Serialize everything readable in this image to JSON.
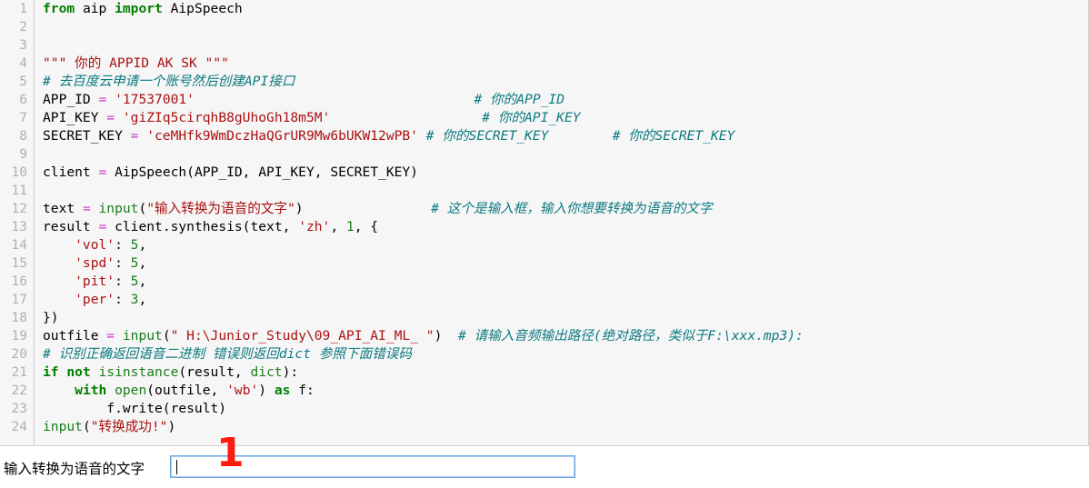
{
  "editor": {
    "background_color": "#f6f6f6",
    "gutter_color": "#b0b0b0",
    "line_numbers": [
      "1",
      "2",
      "3",
      "4",
      "5",
      "6",
      "7",
      "8",
      "9",
      "10",
      "11",
      "12",
      "13",
      "14",
      "15",
      "16",
      "17",
      "18",
      "19",
      "20",
      "21",
      "22",
      "23",
      "24"
    ],
    "lines": [
      {
        "n": "1",
        "text": "from aip import AipSpeech"
      },
      {
        "n": "2",
        "text": ""
      },
      {
        "n": "3",
        "text": ""
      },
      {
        "n": "4",
        "text": "\"\"\" 你的 APPID AK SK \"\"\""
      },
      {
        "n": "5",
        "text": "# 去百度云申请一个账号然后创建API接口"
      },
      {
        "n": "6",
        "text": "APP_ID = '17537001'                                    # 你的APP_ID"
      },
      {
        "n": "7",
        "text": "API_KEY = 'giZIq5cirqhB8gUhoGh18m5M'                    # 你的API_KEY"
      },
      {
        "n": "8",
        "text": "SECRET_KEY = 'ceMHfk9WmDczHaQGrUR9Mw6bUKW12wPB' # 你的SECRET_KEY        # 你的SECRET_KEY"
      },
      {
        "n": "9",
        "text": ""
      },
      {
        "n": "10",
        "text": "client = AipSpeech(APP_ID, API_KEY, SECRET_KEY)"
      },
      {
        "n": "11",
        "text": ""
      },
      {
        "n": "12",
        "text": "text = input(\"输入转换为语音的文字\")              # 这个是输入框，输入你想要转换为语音的文字"
      },
      {
        "n": "13",
        "text": "result = client.synthesis(text, 'zh', 1, {"
      },
      {
        "n": "14",
        "text": "    'vol': 5,"
      },
      {
        "n": "15",
        "text": "    'spd': 5,"
      },
      {
        "n": "16",
        "text": "    'pit': 5,"
      },
      {
        "n": "17",
        "text": "    'per': 3,"
      },
      {
        "n": "18",
        "text": "})"
      },
      {
        "n": "19",
        "text": "outfile = input(\" H:\\Junior_Study\\09_API_AI_ML_ \")  # 请输入音频输出路径(绝对路径，类似于F:\\xxx.mp3):"
      },
      {
        "n": "20",
        "text": "# 识别正确返回语音二进制 错误则返回dict 参照下面错误码"
      },
      {
        "n": "21",
        "text": "if not isinstance(result, dict):"
      },
      {
        "n": "22",
        "text": "    with open(outfile, 'wb') as f:"
      },
      {
        "n": "23",
        "text": "        f.write(result)"
      },
      {
        "n": "24",
        "text": "input(\"转换成功!\")"
      }
    ],
    "tokens": {
      "keyword_color": "#007f00",
      "builtin_color": "#1a7d1a",
      "string_color": "#aa1111",
      "number_color": "#1a7d1a",
      "operator_color": "#cc33cc",
      "comment_color": "#0d7a80",
      "plain_color": "#000000"
    }
  },
  "prompt": {
    "label": "输入转换为语音的文字",
    "input_value": "",
    "input_placeholder": "",
    "border_color": "#6fa8dc",
    "caret_visible": true
  },
  "annotations": {
    "marker_1": "1",
    "marker_1_color": "#ff1a0f"
  },
  "code_parts": {
    "l1_from": "from",
    "l1_aip": " aip ",
    "l1_import": "import",
    "l1_cls": " AipSpeech",
    "l4_doc": "\"\"\" 你的 APPID AK SK \"\"\"",
    "l5_cmt": "# 去百度云申请一个账号然后创建API接口",
    "l6_name": "APP_ID ",
    "l6_eq": "=",
    "l6_str": " '17537001'",
    "l6_pad": "                                   ",
    "l6_cmt": "# 你的APP_ID",
    "l7_name": "API_KEY ",
    "l7_eq": "=",
    "l7_str": " 'giZIq5cirqhB8gUhoGh18m5M'",
    "l7_pad": "                   ",
    "l7_cmt": "# 你的API_KEY",
    "l8_name": "SECRET_KEY ",
    "l8_eq": "=",
    "l8_str": " 'ceMHfk9WmDczHaQGrUR9Mw6bUKW12wPB'",
    "l8_cmt1": " # 你的SECRET_KEY",
    "l8_pad": "        ",
    "l8_cmt2": "# 你的SECRET_KEY",
    "l10_name": "client ",
    "l10_eq": "=",
    "l10_call": " AipSpeech(APP_ID, API_KEY, SECRET_KEY)",
    "l12_name": "text ",
    "l12_eq": "=",
    "l12_input": " input",
    "l12_open": "(",
    "l12_str": "\"输入转换为语音的文字\"",
    "l12_close": ")",
    "l12_pad": "                ",
    "l12_cmt": "# 这个是输入框，输入你想要转换为语音的文字",
    "l13_name": "result ",
    "l13_eq": "=",
    "l13_call": " client.synthesis(text, ",
    "l13_str": "'zh'",
    "l13_mid": ", ",
    "l13_num": "1",
    "l13_end": ", {",
    "l14_str": "    'vol'",
    "l14_colon": ": ",
    "l14_num": "5",
    "l14_comma": ",",
    "l15_str": "    'spd'",
    "l15_num": "5",
    "l16_str": "    'pit'",
    "l16_num": "5",
    "l17_str": "    'per'",
    "l17_num": "3",
    "l18_text": "})",
    "l19_name": "outfile ",
    "l19_eq": "=",
    "l19_input": " input",
    "l19_open": "(",
    "l19_str": "\" H:\\Junior_Study\\09_API_AI_ML_ \"",
    "l19_close": ")",
    "l19_pad": "  ",
    "l19_cmt": "# 请输入音频输出路径(绝对路径，类似于F:\\xxx.mp3):",
    "l20_cmt": "# 识别正确返回语音二进制 错误则返回dict 参照下面错误码",
    "l21_if": "if not",
    "l21_isinstance": " isinstance",
    "l21_open": "(result, ",
    "l21_dict": "dict",
    "l21_close": "):",
    "l22_indent": "    ",
    "l22_with": "with",
    "l22_open": " open",
    "l22_p1": "(outfile, ",
    "l22_str": "'wb'",
    "l22_p2": ") ",
    "l22_as": "as",
    "l22_f": " f:",
    "l23_text": "        f.write(result)",
    "l24_input": "input",
    "l24_open": "(",
    "l24_str": "\"转换成功!\"",
    "l24_close": ")"
  }
}
